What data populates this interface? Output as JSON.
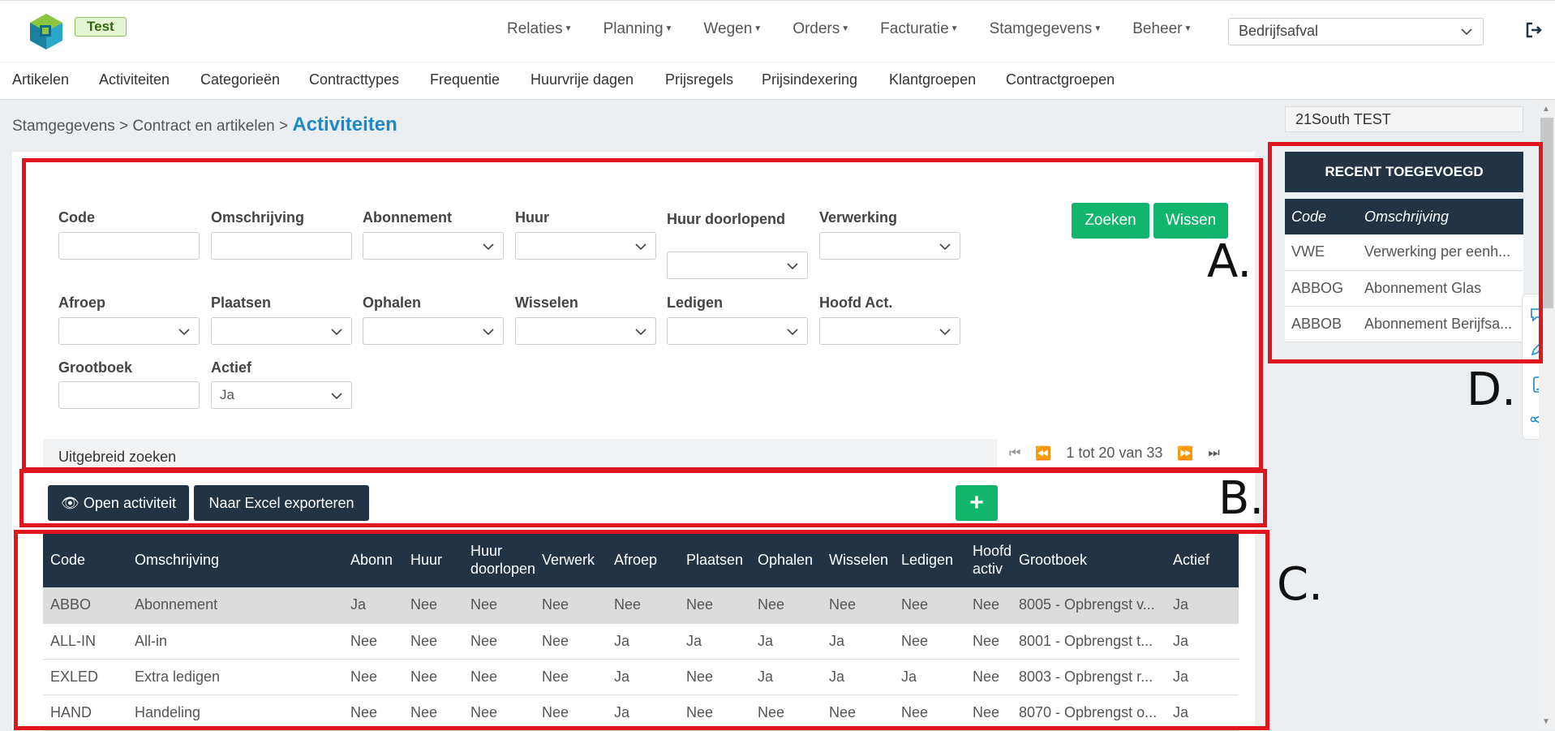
{
  "header": {
    "env_badge": "Test",
    "nav": [
      "Relaties",
      "Planning",
      "Wegen",
      "Orders",
      "Facturatie",
      "Stamgegevens",
      "Beheer"
    ],
    "company_select": "Bedrijfsafval"
  },
  "subnav": [
    "Artikelen",
    "Activiteiten",
    "Categorieën",
    "Contracttypes",
    "Frequentie",
    "Huurvrije dagen",
    "Prijsregels",
    "Prijsindexering",
    "Klantgroepen",
    "Contractgroepen"
  ],
  "breadcrumb": {
    "path": "Stamgegevens > Contract en artikelen >",
    "current": "Activiteiten"
  },
  "filters": {
    "code": "Code",
    "omschrijving": "Omschrijving",
    "abonnement": "Abonnement",
    "huur": "Huur",
    "huur_doorlopend": "Huur doorlopend",
    "verwerking": "Verwerking",
    "afroep": "Afroep",
    "plaatsen": "Plaatsen",
    "ophalen": "Ophalen",
    "wisselen": "Wisselen",
    "ledigen": "Ledigen",
    "hoofd_act": "Hoofd Act.",
    "grootboek": "Grootboek",
    "actief": "Actief",
    "actief_value": "Ja",
    "zoeken": "Zoeken",
    "wissen": "Wissen",
    "uitgebreid": "Uitgebreid zoeken"
  },
  "pager": {
    "text": "1 tot 20 van 33"
  },
  "toolbar": {
    "open": "Open activiteit",
    "excel": "Naar Excel exporteren",
    "add": "+"
  },
  "table": {
    "headers": [
      "Code",
      "Omschrijving",
      "Abonn",
      "Huur",
      "Huur doorlopend",
      "Verwerk",
      "Afroep",
      "Plaatsen",
      "Ophalen",
      "Wisselen",
      "Ledigen",
      "Hoofd activ",
      "Grootboek",
      "Actief"
    ],
    "rows": [
      [
        "ABBO",
        "Abonnement",
        "Ja",
        "Nee",
        "Nee",
        "Nee",
        "Nee",
        "Nee",
        "Nee",
        "Nee",
        "Nee",
        "Nee",
        "8005 - Opbrengst v...",
        "Ja"
      ],
      [
        "ALL-IN",
        "All-in",
        "Nee",
        "Nee",
        "Nee",
        "Nee",
        "Ja",
        "Ja",
        "Ja",
        "Ja",
        "Nee",
        "Nee",
        "8001 - Opbrengst t...",
        "Ja"
      ],
      [
        "EXLED",
        "Extra ledigen",
        "Nee",
        "Nee",
        "Nee",
        "Nee",
        "Ja",
        "Nee",
        "Ja",
        "Ja",
        "Ja",
        "Nee",
        "8003 - Opbrengst r...",
        "Ja"
      ],
      [
        "HAND",
        "Handeling",
        "Nee",
        "Nee",
        "Nee",
        "Nee",
        "Ja",
        "Nee",
        "Nee",
        "Nee",
        "Nee",
        "Nee",
        "8070 - Opbrengst o...",
        "Ja"
      ]
    ]
  },
  "right": {
    "company": "21South TEST",
    "recent_title": "RECENT TOEGEVOEGD",
    "recent_headers": [
      "Code",
      "Omschrijving"
    ],
    "recent_rows": [
      [
        "VWE",
        "Verwerking per eenh..."
      ],
      [
        "ABBOG",
        "Abonnement Glas"
      ],
      [
        "ABBOB",
        "Abonnement Berijfsa..."
      ]
    ]
  },
  "annotations": [
    "A.",
    "B.",
    "C.",
    "D."
  ],
  "colors": {
    "navy": "#213344",
    "green": "#11b56b",
    "accent_blue": "#1e88c8",
    "annotation_red": "#e0161f"
  }
}
